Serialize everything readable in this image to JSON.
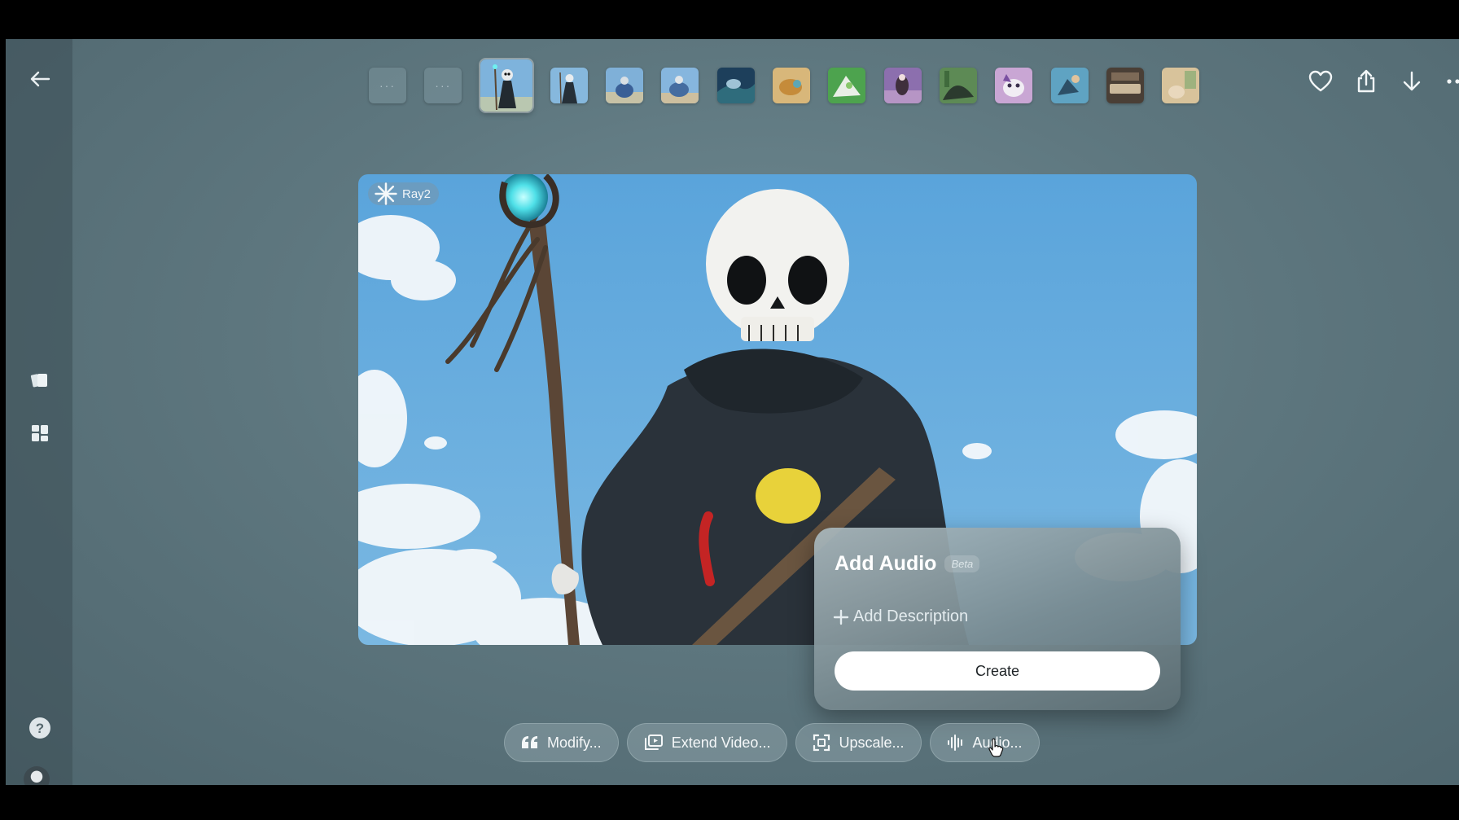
{
  "sidebar": {
    "items": [
      {
        "name": "back-arrow-icon"
      },
      {
        "name": "library-icon"
      },
      {
        "name": "grid-icon"
      },
      {
        "name": "help-icon",
        "glyph": "?"
      }
    ]
  },
  "thumbnails": {
    "placeholder_glyph": "···",
    "count": 15,
    "active_index": 2
  },
  "top_actions": [
    {
      "name": "favorite-icon"
    },
    {
      "name": "share-icon"
    },
    {
      "name": "download-icon"
    },
    {
      "name": "more-icon"
    }
  ],
  "stage": {
    "model_badge": "Ray2"
  },
  "audio_panel": {
    "title": "Add Audio",
    "badge": "Beta",
    "add_description": "Add Description",
    "create_label": "Create"
  },
  "actions": {
    "modify": "Modify...",
    "extend": "Extend Video...",
    "upscale": "Upscale...",
    "audio": "Audio..."
  },
  "colors": {
    "background": "#5e777f",
    "panel": "#8a9ca2",
    "create_button": "#ffffff"
  }
}
